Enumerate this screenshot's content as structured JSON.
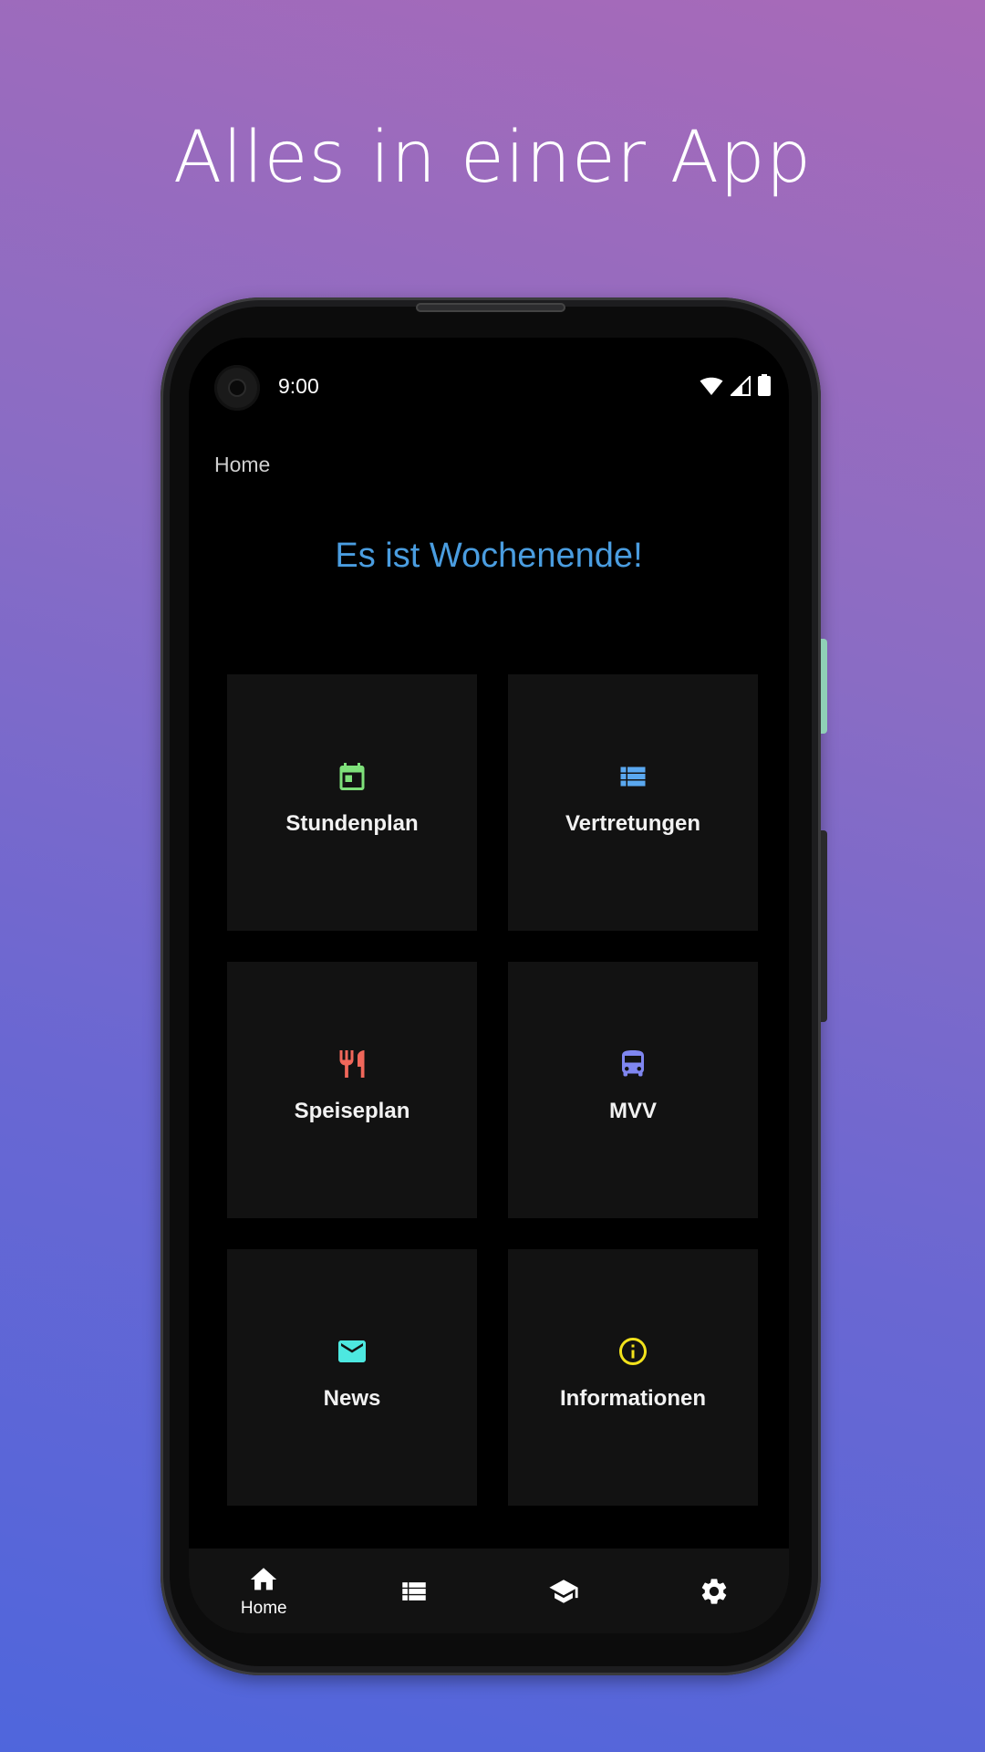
{
  "promo": {
    "headline": "Alles in einer App"
  },
  "status_bar": {
    "time": "9:00",
    "icons": [
      "wifi-icon",
      "cell-signal-icon",
      "battery-icon"
    ]
  },
  "app": {
    "page_title": "Home",
    "banner": "Es ist Wochenende!",
    "banner_color": "#4a9de0",
    "tiles": [
      {
        "label": "Stundenplan",
        "icon": "calendar-icon",
        "color": "#7ee07a"
      },
      {
        "label": "Vertretungen",
        "icon": "list-icon",
        "color": "#5aa8f0"
      },
      {
        "label": "Speiseplan",
        "icon": "restaurant-icon",
        "color": "#f0675a"
      },
      {
        "label": "MVV",
        "icon": "bus-icon",
        "color": "#7f86f0"
      },
      {
        "label": "News",
        "icon": "mail-icon",
        "color": "#4de8e0"
      },
      {
        "label": "Informationen",
        "icon": "info-icon",
        "color": "#f2e21c"
      }
    ],
    "bottom_nav": [
      {
        "label": "Home",
        "icon": "home-icon",
        "active": true
      },
      {
        "label": "",
        "icon": "list-icon",
        "active": false
      },
      {
        "label": "",
        "icon": "school-icon",
        "active": false
      },
      {
        "label": "",
        "icon": "settings-icon",
        "active": false
      }
    ]
  }
}
